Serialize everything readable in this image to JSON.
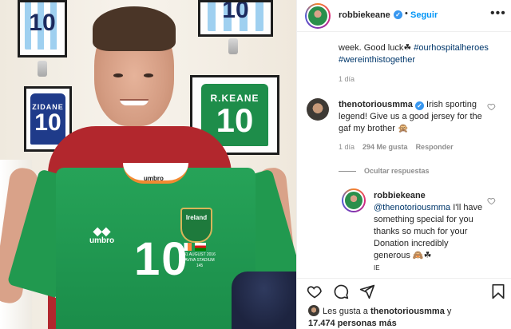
{
  "post": {
    "username": "robbiekeane",
    "follow_label": "Seguir",
    "caption_cut": "week. Good luck☘ #ourhospitalheroes",
    "caption_line1_text": "week. Good luck☘ ",
    "caption_hashtag1": "#ourhospitalheroes",
    "caption_hashtag2": "#wereinthistogether",
    "time": "1 día"
  },
  "photo": {
    "frame_zidane_name": "ZIDANE",
    "frame_zidane_number": "10",
    "frame_keane_name": "R.KEANE",
    "frame_keane_number": "10",
    "frame_arg_number": "10",
    "jersey_brand": "umbro",
    "collar_label": "umbro",
    "crest_text": "Ireland",
    "match_date": "31 AUGUST 2016",
    "match_venue": "AVIVA STADIUM",
    "match_no": "145",
    "jersey_number": "10"
  },
  "comments": [
    {
      "user": "thenotoriousmma",
      "text_before_mention": " Irish sporting legend! Give us a good jersey for the gaf my brother 🙊",
      "time": "1 día",
      "likes": "294 Me gusta",
      "reply_label": "Responder"
    },
    {
      "user": "robbiekeane",
      "mention": "@thenotoriousmma",
      "text": " I'll have something special for you thanks so much for your Donation incredibly generous 🙈☘",
      "flag_tail": "IE"
    }
  ],
  "hide_replies_label": "Ocultar respuestas",
  "likes_summary": {
    "prefix": "Les gusta a ",
    "user": "thenotoriousmma",
    "middle": " y",
    "count": "17.474 personas más"
  },
  "colors": {
    "accent_blue": "#0095f6",
    "link_dark_blue": "#00376b",
    "verified_blue": "#3897f0",
    "meta_gray": "#8e8e8e"
  },
  "icons": [
    "more-options-icon",
    "verified-badge-icon",
    "heart-icon",
    "comment-icon",
    "share-icon",
    "bookmark-icon"
  ]
}
